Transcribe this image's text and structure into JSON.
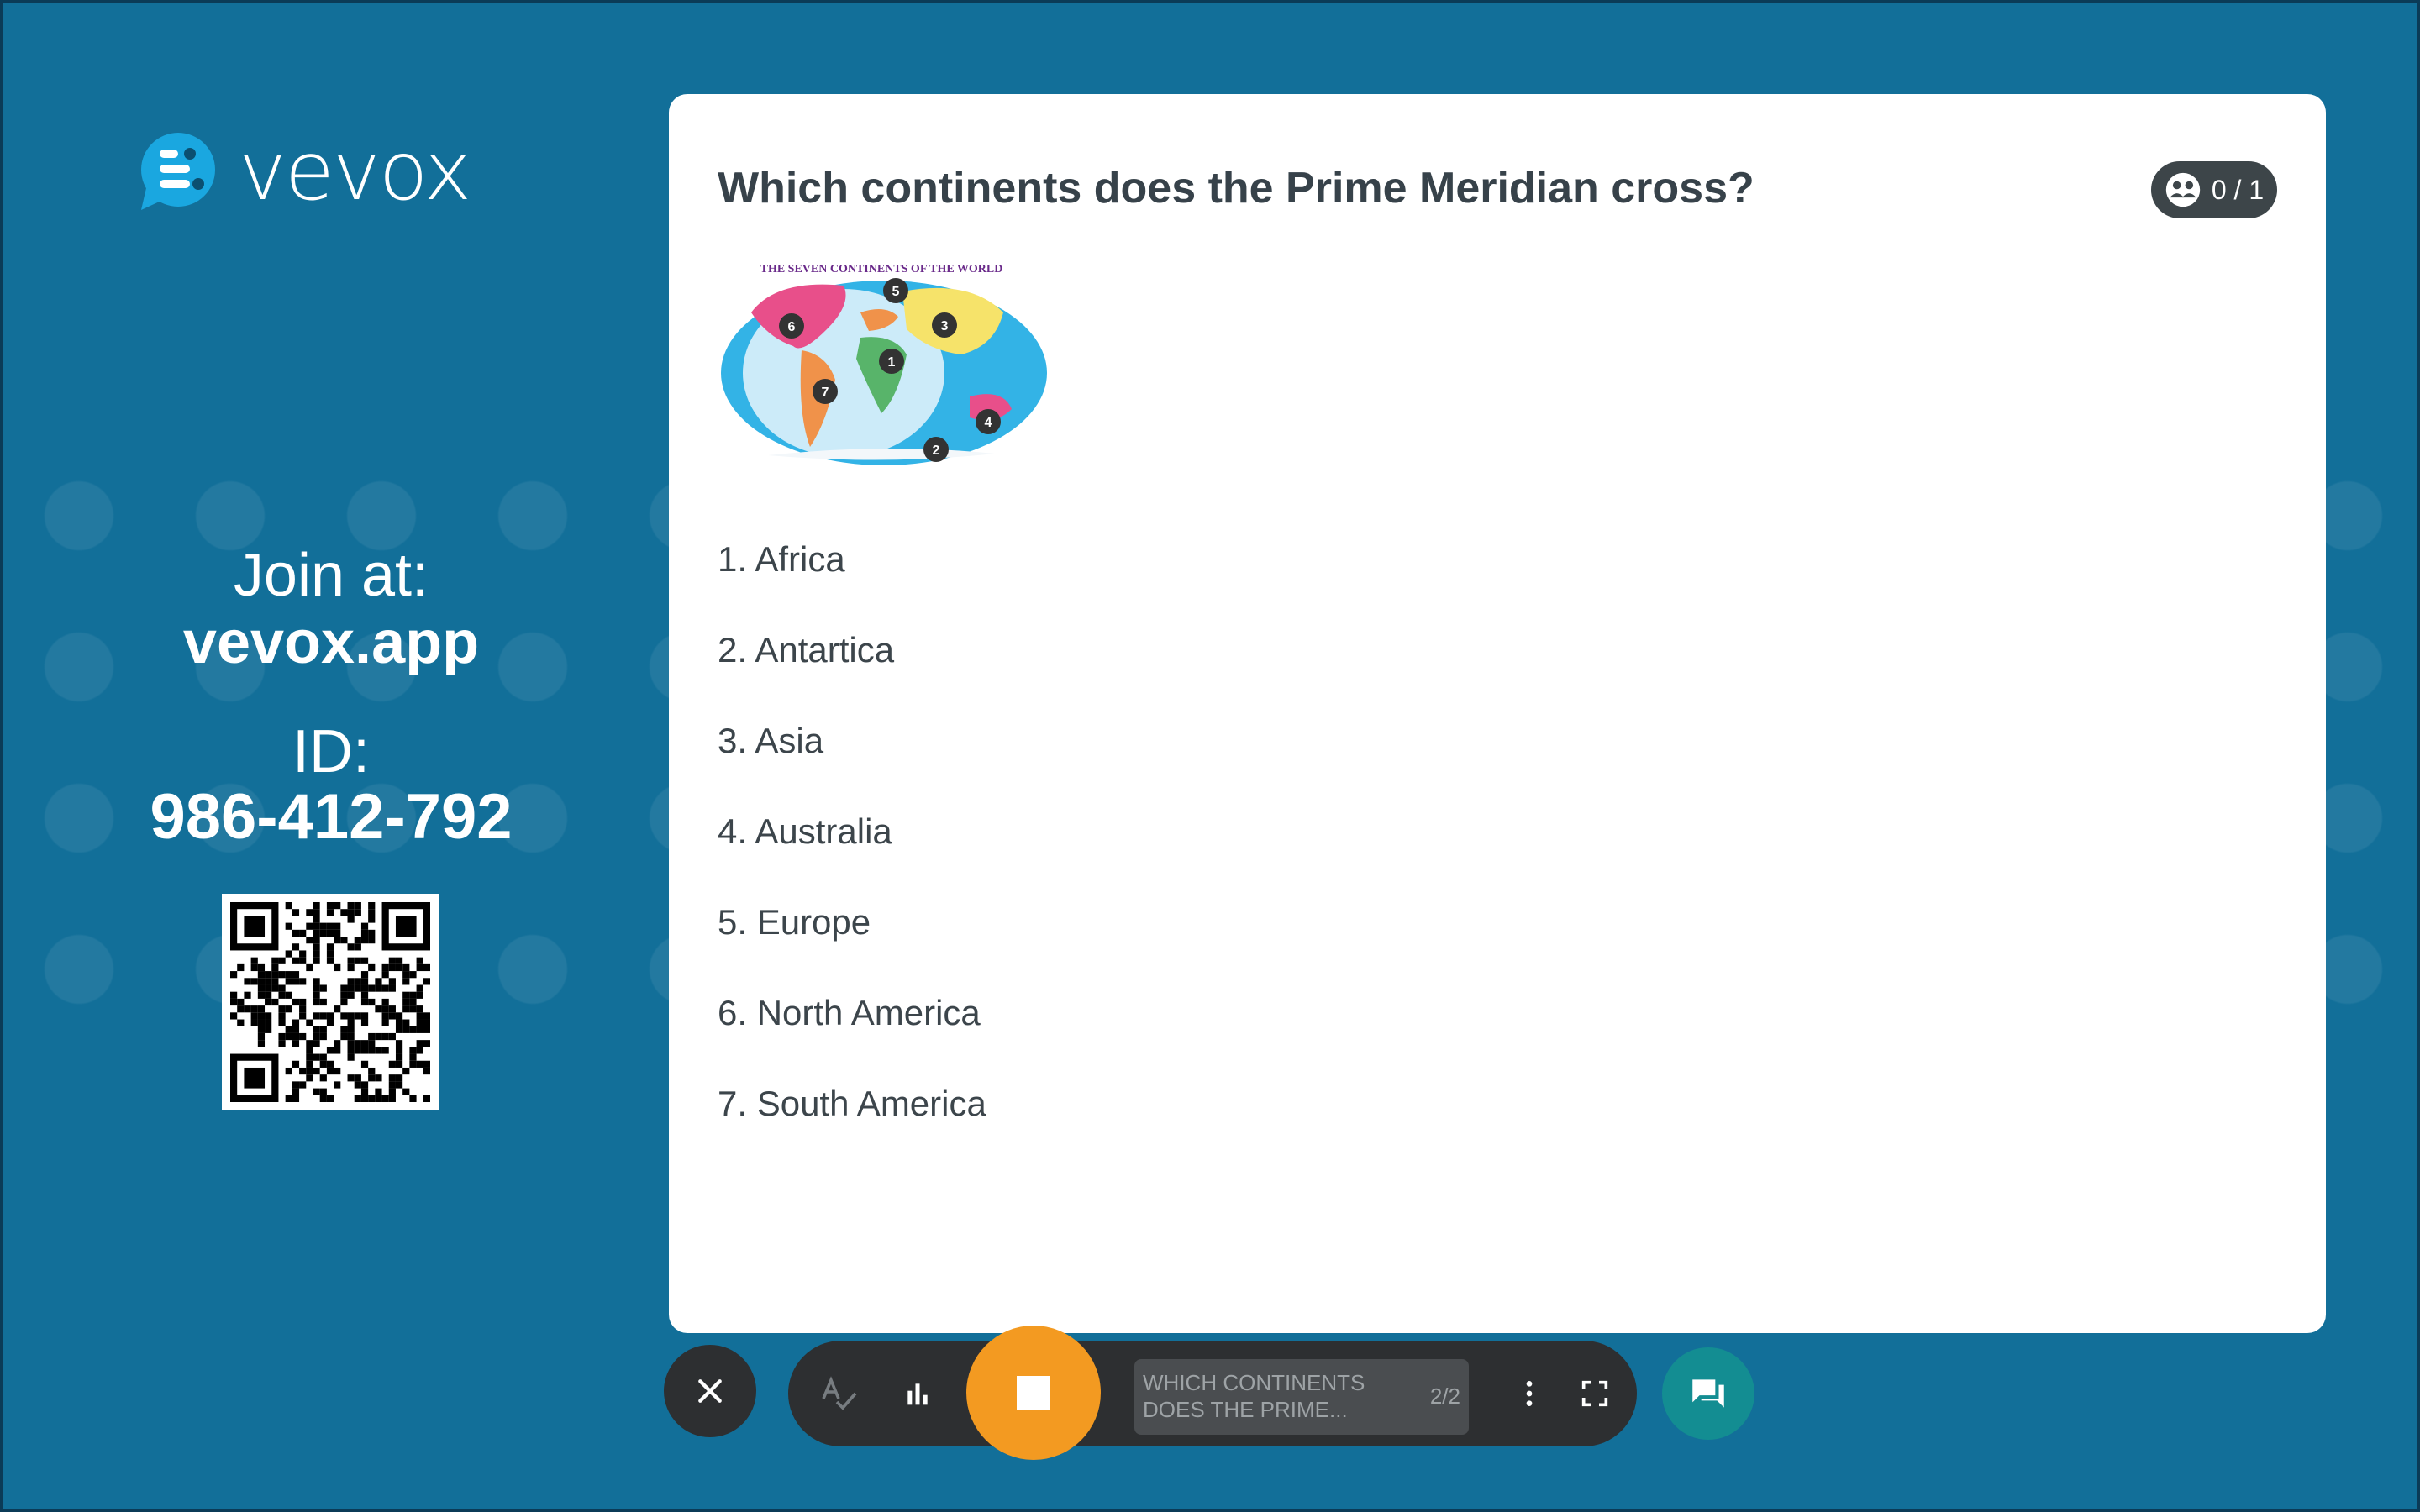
{
  "brand": {
    "name": "vevox",
    "accent": "#1aa7e0"
  },
  "join": {
    "label": "Join at:",
    "url": "vevox.app",
    "id_label": "ID:",
    "id_value": "986-412-792"
  },
  "question": {
    "title": "Which continents does the Prime Meridian cross?",
    "responses": "0 / 1",
    "image_caption": "THE SEVEN CONTINENTS OF THE WORLD",
    "map_markers": [
      "1",
      "2",
      "3",
      "4",
      "5",
      "6",
      "7"
    ],
    "options": [
      "1. Africa",
      "2. Antartica",
      "3. Asia",
      "4. Australia",
      "5. Europe",
      "6. North America",
      "7. South America"
    ]
  },
  "toolbar": {
    "preview_text": "WHICH CONTINENTS DOES THE PRIME...",
    "position": "2/2",
    "icons": [
      "close-icon",
      "spellcheck-icon",
      "bar-chart-icon",
      "stop-icon",
      "more-vert-icon",
      "fullscreen-icon",
      "chat-icon"
    ]
  },
  "colors": {
    "background": "#126f99",
    "stop": "#f39a21",
    "chat": "#138d92",
    "toolbar": "#2d2f31"
  }
}
